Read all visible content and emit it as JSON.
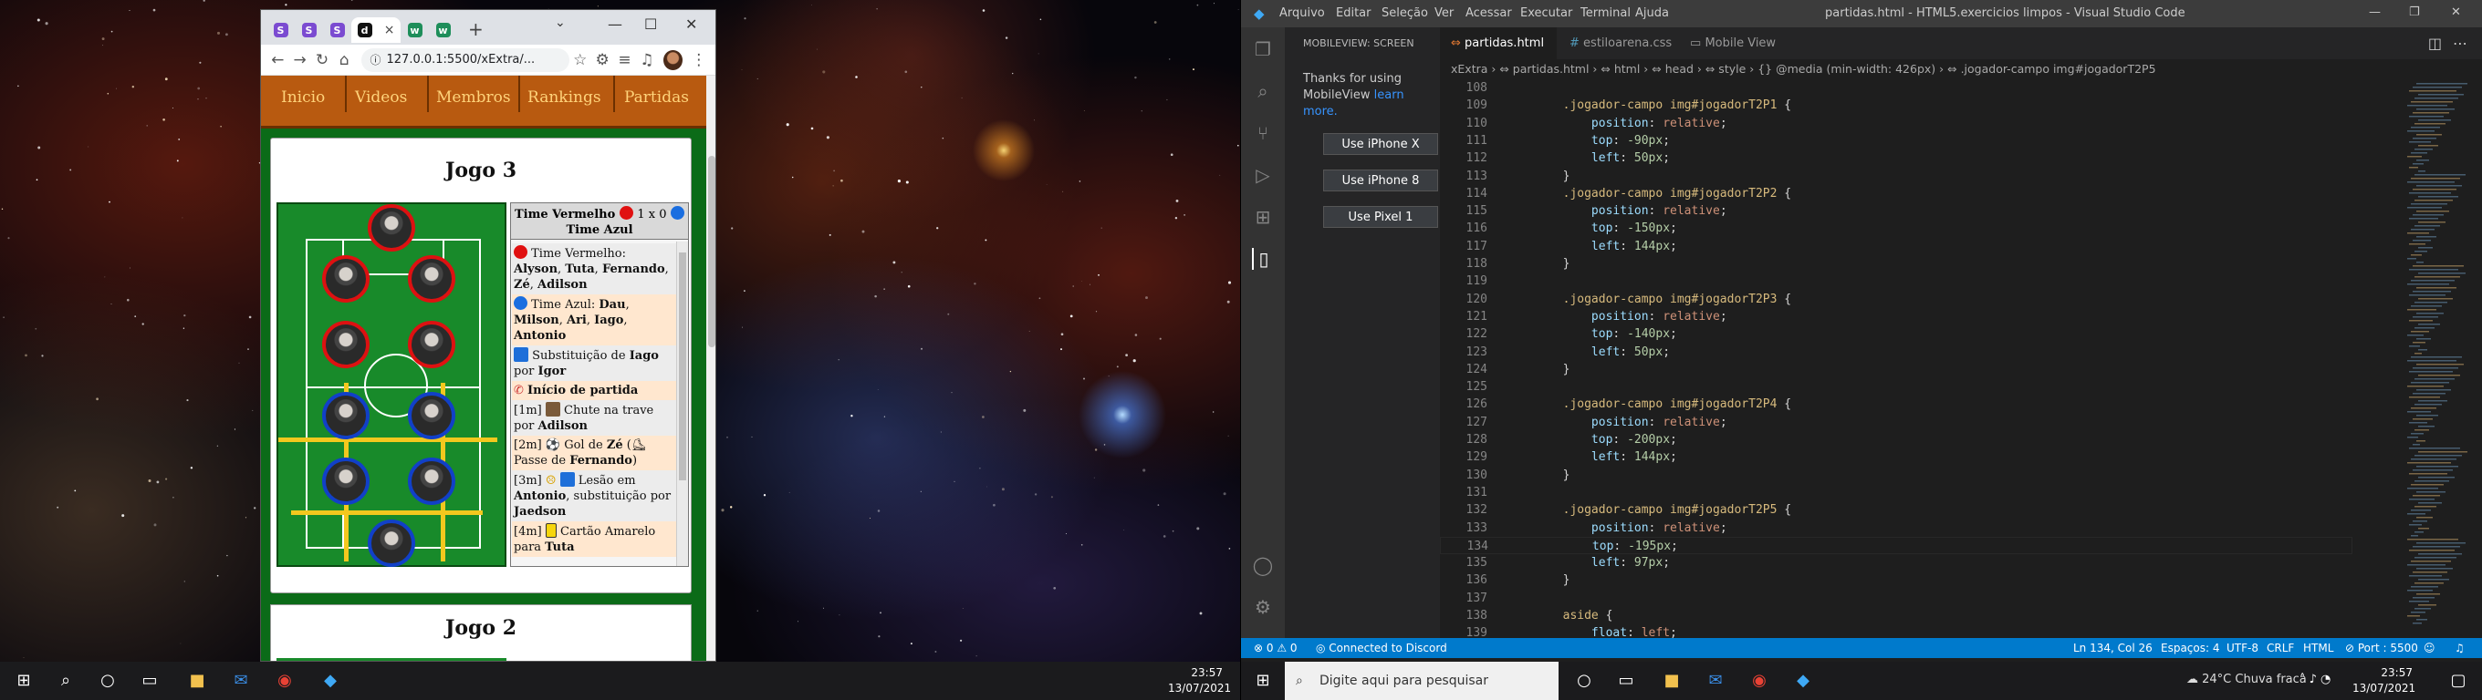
{
  "browser": {
    "tabs": [
      "S",
      "S",
      "S",
      "d",
      "w",
      "w"
    ],
    "active_tab_close": "×",
    "new_tab": "+",
    "window_controls": [
      "—",
      "☐",
      "✕"
    ],
    "url": "127.0.0.1:5500/xExtra/...",
    "nav_labels": [
      "Inicio",
      "Videos",
      "Membros",
      "Rankings",
      "Partidas"
    ],
    "game_title": "Jogo 3",
    "game_title_2": "Jogo 2",
    "score_line1": "Time Vermelho",
    "score_mid": "1 x 0",
    "score_line2": "Time Azul",
    "events": [
      {
        "type": "lineup",
        "parts": [
          "Time Vermelho: ",
          "Alyson",
          ", ",
          "Tuta",
          ", ",
          "Fernando",
          ", ",
          "Zé",
          ", ",
          "Adilson"
        ]
      },
      {
        "type": "lineup",
        "parts": [
          "Time Azul: ",
          "Dau",
          ", ",
          "Milson",
          ", ",
          "Ari",
          ", ",
          "Iago",
          ", ",
          "Antonio"
        ]
      },
      {
        "type": "sub",
        "parts": [
          "Substituição de ",
          "Iago",
          " por ",
          "Igor"
        ]
      },
      {
        "type": "start",
        "parts": [
          "",
          "Início de partida"
        ]
      },
      {
        "type": "time",
        "parts": [
          "[1m] ",
          "",
          " Chute na trave por ",
          "Adilson"
        ]
      },
      {
        "type": "time",
        "parts": [
          "[2m] ",
          "",
          " Gol de ",
          "Zé",
          " (",
          "",
          " Passe de ",
          "Fernando",
          ")"
        ]
      },
      {
        "type": "time",
        "parts": [
          "[3m] ",
          "",
          " Lesão em ",
          "Antonio",
          ", substituição por ",
          "Jaedson"
        ]
      },
      {
        "type": "time",
        "parts": [
          "[4m] ",
          "",
          " Cartão Amarelo para ",
          "Tuta"
        ]
      }
    ]
  },
  "vscode": {
    "menu": [
      "Arquivo",
      "Editar",
      "Seleção",
      "Ver",
      "Acessar",
      "Executar",
      "Terminal",
      "Ajuda"
    ],
    "window_title": "partidas.html - HTML5.exercicios limpos - Visual Studio Code",
    "side_title": "MOBILEVIEW: SCREEN",
    "side_text": "Thanks for using MobileView",
    "side_link": "learn more.",
    "side_buttons": [
      "Use iPhone X",
      "Use iPhone 8",
      "Use Pixel 1"
    ],
    "tabs": [
      {
        "label": "partidas.html",
        "active": true
      },
      {
        "label": "estiloarena.css",
        "active": false
      },
      {
        "label": "Mobile View",
        "active": false
      }
    ],
    "breadcrumb": "xExtra › ⇔ partidas.html › ⇔ html › ⇔ head › ⇔ style › {} @media (min-width: 426px) › ⇔ .jogador-campo img#jogadorT2P5",
    "lines": [
      {
        "n": "108",
        "t": ""
      },
      {
        "n": "109",
        "sel": ".jogador-campo img#jogadorT2P1",
        "t": " {"
      },
      {
        "n": "110",
        "prop": "position",
        "val": "relative"
      },
      {
        "n": "111",
        "prop": "top",
        "val": "-90px"
      },
      {
        "n": "112",
        "prop": "left",
        "val": "50px"
      },
      {
        "n": "113",
        "t": "}"
      },
      {
        "n": "114",
        "sel": ".jogador-campo img#jogadorT2P2",
        "t": " {"
      },
      {
        "n": "115",
        "prop": "position",
        "val": "relative"
      },
      {
        "n": "116",
        "prop": "top",
        "val": "-150px"
      },
      {
        "n": "117",
        "prop": "left",
        "val": "144px"
      },
      {
        "n": "118",
        "t": "}"
      },
      {
        "n": "119",
        "t": ""
      },
      {
        "n": "120",
        "sel": ".jogador-campo img#jogadorT2P3",
        "t": " {"
      },
      {
        "n": "121",
        "prop": "position",
        "val": "relative"
      },
      {
        "n": "122",
        "prop": "top",
        "val": "-140px"
      },
      {
        "n": "123",
        "prop": "left",
        "val": "50px"
      },
      {
        "n": "124",
        "t": "}"
      },
      {
        "n": "125",
        "t": ""
      },
      {
        "n": "126",
        "sel": ".jogador-campo img#jogadorT2P4",
        "t": " {"
      },
      {
        "n": "127",
        "prop": "position",
        "val": "relative"
      },
      {
        "n": "128",
        "prop": "top",
        "val": "-200px"
      },
      {
        "n": "129",
        "prop": "left",
        "val": "144px"
      },
      {
        "n": "130",
        "t": "}"
      },
      {
        "n": "131",
        "t": ""
      },
      {
        "n": "132",
        "sel": ".jogador-campo img#jogadorT2P5",
        "t": " {"
      },
      {
        "n": "133",
        "prop": "position",
        "val": "relative"
      },
      {
        "n": "134",
        "prop": "top",
        "val": "-195px"
      },
      {
        "n": "135",
        "prop": "left",
        "val": "97px"
      },
      {
        "n": "136",
        "t": "}"
      },
      {
        "n": "137",
        "t": ""
      },
      {
        "n": "138",
        "sel": "aside",
        "t": " {"
      },
      {
        "n": "139",
        "prop": "float",
        "val": "left"
      }
    ],
    "status": {
      "errors": "⊗ 0 ⚠ 0",
      "discord": "Connected to Discord",
      "position": "Ln 134, Col 26",
      "spaces": "Espaços: 4",
      "encoding": "UTF-8",
      "eol": "CRLF",
      "language": "HTML",
      "port": "Port : 5500"
    }
  },
  "taskbar": {
    "time": "23:57",
    "date": "13/07/2021",
    "search_placeholder": "Digite aqui para pesquisar",
    "weather": "24°C  Chuva fraca"
  }
}
